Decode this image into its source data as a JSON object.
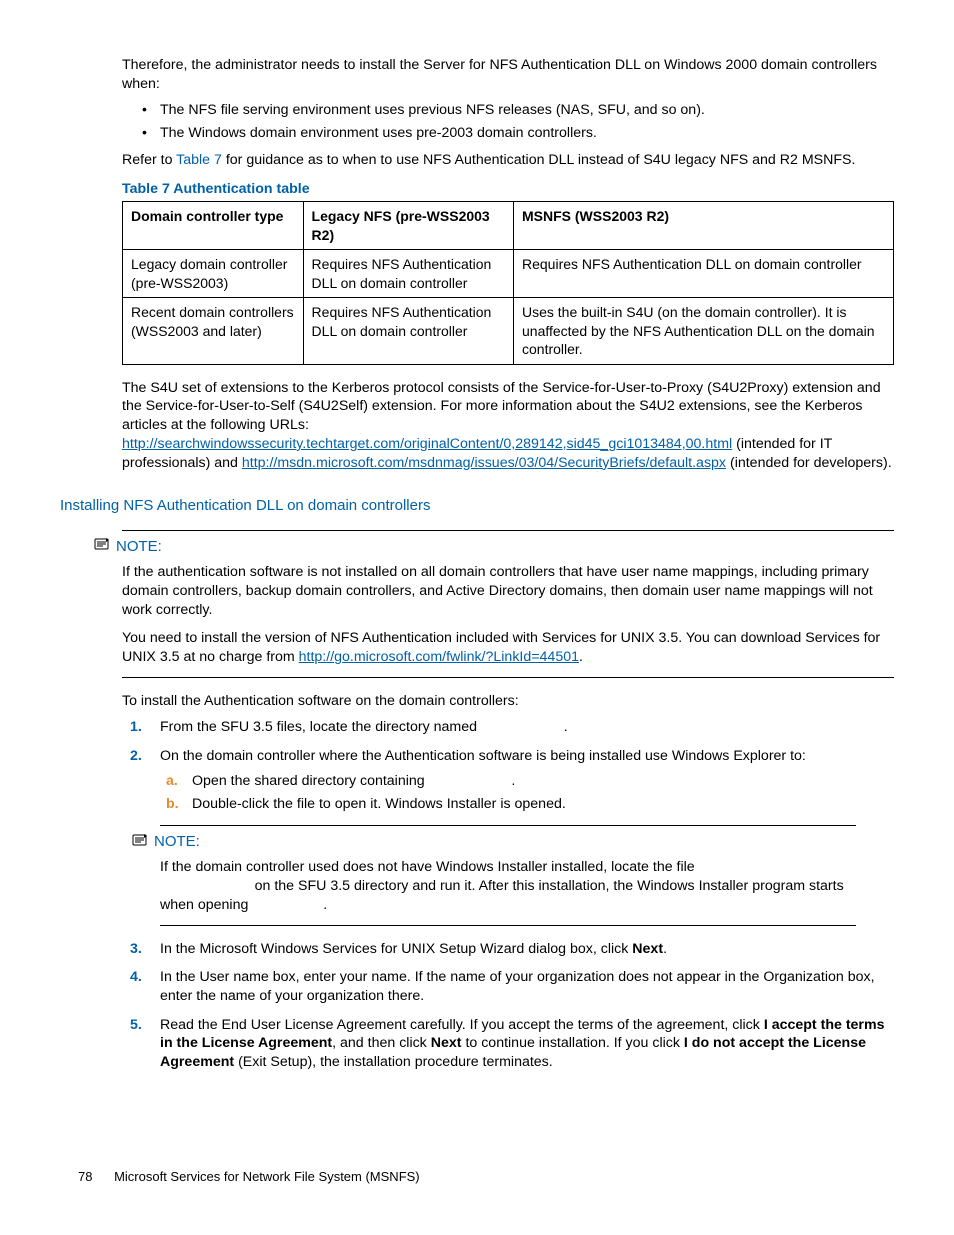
{
  "intro": {
    "para": "Therefore, the administrator needs to install the Server for NFS Authentication DLL on Windows 2000 domain controllers when:",
    "bullets": [
      "The NFS file serving environment uses previous NFS releases (NAS, SFU, and so on).",
      "The Windows domain environment uses pre-2003 domain controllers."
    ],
    "refer_pre": "Refer to ",
    "refer_link": "Table 7",
    "refer_post": " for guidance as to when to use NFS Authentication DLL instead of S4U legacy NFS and R2 MSNFS."
  },
  "table": {
    "caption": "Table 7 Authentication table",
    "headers": [
      "Domain controller type",
      "Legacy NFS (pre-WSS2003 R2)",
      "MSNFS (WSS2003 R2)"
    ],
    "rows": [
      [
        "Legacy domain controller (pre-WSS2003)",
        "Requires NFS Authentication DLL on domain controller",
        "Requires NFS Authentication DLL on domain controller"
      ],
      [
        "Recent domain controllers (WSS2003 and later)",
        "Requires NFS Authentication DLL on domain controller",
        "Uses the built-in S4U (on the domain controller). It is unaffected by the NFS Authentication DLL on the domain controller."
      ]
    ]
  },
  "s4u": {
    "pre": "The S4U set of extensions to the Kerberos protocol consists of the Service-for-User-to-Proxy (S4U2Proxy) extension and the Service-for-User-to-Self (S4U2Self) extension. For more information about the S4U2 extensions, see the Kerberos articles at the following URLs: ",
    "link1": "http://searchwindowssecurity.techtarget.com/originalContent/0,289142,sid45_gci1013484,00.html",
    "mid1": " (intended for IT professionals) and ",
    "link2": "http://msdn.microsoft.com/msdnmag/issues/03/04/SecurityBriefs/default.aspx",
    "post": " (intended for developers)."
  },
  "section_heading": "Installing NFS Authentication DLL on domain controllers",
  "note1": {
    "label": "NOTE:",
    "p1": "If the authentication software is not installed on all domain controllers that have user name mappings, including primary domain controllers, backup domain controllers, and Active Directory domains, then domain user name mappings will not work correctly.",
    "p2_pre": "You need to install the version of NFS Authentication included with Services for UNIX 3.5. You can download Services for UNIX 3.5 at no charge from ",
    "p2_link": "http://go.microsoft.com/fwlink/?LinkId=44501",
    "p2_post": "."
  },
  "install_lead": "To install the Authentication software on the domain controllers:",
  "steps": {
    "s1": "From the SFU 3.5 files, locate the directory named",
    "s1_end": ".",
    "s2": "On the domain controller where the Authentication software is being installed use Windows Explorer to:",
    "s2a": "Open the shared directory containing",
    "s2a_end": ".",
    "s2b": "Double-click the file to open it. Windows Installer is opened.",
    "s3_pre": "In the Microsoft Windows Services for UNIX Setup Wizard dialog box, click ",
    "s3_bold": "Next",
    "s3_post": ".",
    "s4": "In the User name box, enter your name. If the name of your organization does not appear in the Organization box, enter the name of your organization there.",
    "s5_a": "Read the End User License Agreement carefully. If you accept the terms of the agreement, click ",
    "s5_b1": "I accept the terms in the License Agreement",
    "s5_c": ", and then click ",
    "s5_b2": "Next",
    "s5_d": " to continue installation. If you click ",
    "s5_b3": "I do not accept the License Agreement",
    "s5_e": " (Exit Setup), the installation procedure terminates."
  },
  "note2": {
    "label": "NOTE:",
    "line1": "If the domain controller used does not have Windows Installer installed, locate the file",
    "line2": " on the SFU 3.5 directory and run it. After this installation, the Windows Installer program starts when opening",
    "line2_end": "."
  },
  "footer": {
    "page": "78",
    "title": "Microsoft Services for Network File System (MSNFS)"
  }
}
